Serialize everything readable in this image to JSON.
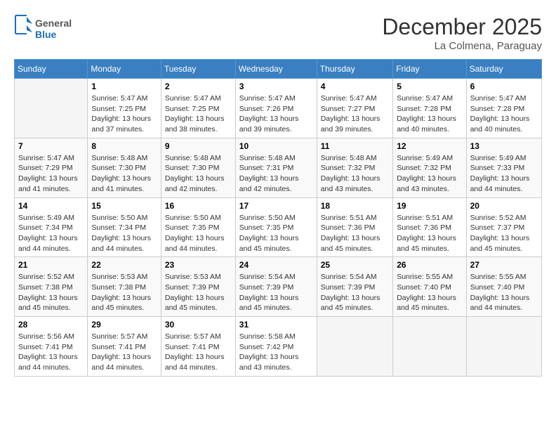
{
  "header": {
    "logo_general": "General",
    "logo_blue": "Blue",
    "month": "December 2025",
    "location": "La Colmena, Paraguay"
  },
  "weekdays": [
    "Sunday",
    "Monday",
    "Tuesday",
    "Wednesday",
    "Thursday",
    "Friday",
    "Saturday"
  ],
  "weeks": [
    [
      {
        "day": "",
        "sunrise": "",
        "sunset": "",
        "daylight": "",
        "empty": true
      },
      {
        "day": "1",
        "sunrise": "Sunrise: 5:47 AM",
        "sunset": "Sunset: 7:25 PM",
        "daylight": "Daylight: 13 hours and 37 minutes."
      },
      {
        "day": "2",
        "sunrise": "Sunrise: 5:47 AM",
        "sunset": "Sunset: 7:25 PM",
        "daylight": "Daylight: 13 hours and 38 minutes."
      },
      {
        "day": "3",
        "sunrise": "Sunrise: 5:47 AM",
        "sunset": "Sunset: 7:26 PM",
        "daylight": "Daylight: 13 hours and 39 minutes."
      },
      {
        "day": "4",
        "sunrise": "Sunrise: 5:47 AM",
        "sunset": "Sunset: 7:27 PM",
        "daylight": "Daylight: 13 hours and 39 minutes."
      },
      {
        "day": "5",
        "sunrise": "Sunrise: 5:47 AM",
        "sunset": "Sunset: 7:28 PM",
        "daylight": "Daylight: 13 hours and 40 minutes."
      },
      {
        "day": "6",
        "sunrise": "Sunrise: 5:47 AM",
        "sunset": "Sunset: 7:28 PM",
        "daylight": "Daylight: 13 hours and 40 minutes."
      }
    ],
    [
      {
        "day": "7",
        "sunrise": "Sunrise: 5:47 AM",
        "sunset": "Sunset: 7:29 PM",
        "daylight": "Daylight: 13 hours and 41 minutes."
      },
      {
        "day": "8",
        "sunrise": "Sunrise: 5:48 AM",
        "sunset": "Sunset: 7:30 PM",
        "daylight": "Daylight: 13 hours and 41 minutes."
      },
      {
        "day": "9",
        "sunrise": "Sunrise: 5:48 AM",
        "sunset": "Sunset: 7:30 PM",
        "daylight": "Daylight: 13 hours and 42 minutes."
      },
      {
        "day": "10",
        "sunrise": "Sunrise: 5:48 AM",
        "sunset": "Sunset: 7:31 PM",
        "daylight": "Daylight: 13 hours and 42 minutes."
      },
      {
        "day": "11",
        "sunrise": "Sunrise: 5:48 AM",
        "sunset": "Sunset: 7:32 PM",
        "daylight": "Daylight: 13 hours and 43 minutes."
      },
      {
        "day": "12",
        "sunrise": "Sunrise: 5:49 AM",
        "sunset": "Sunset: 7:32 PM",
        "daylight": "Daylight: 13 hours and 43 minutes."
      },
      {
        "day": "13",
        "sunrise": "Sunrise: 5:49 AM",
        "sunset": "Sunset: 7:33 PM",
        "daylight": "Daylight: 13 hours and 44 minutes."
      }
    ],
    [
      {
        "day": "14",
        "sunrise": "Sunrise: 5:49 AM",
        "sunset": "Sunset: 7:34 PM",
        "daylight": "Daylight: 13 hours and 44 minutes."
      },
      {
        "day": "15",
        "sunrise": "Sunrise: 5:50 AM",
        "sunset": "Sunset: 7:34 PM",
        "daylight": "Daylight: 13 hours and 44 minutes."
      },
      {
        "day": "16",
        "sunrise": "Sunrise: 5:50 AM",
        "sunset": "Sunset: 7:35 PM",
        "daylight": "Daylight: 13 hours and 44 minutes."
      },
      {
        "day": "17",
        "sunrise": "Sunrise: 5:50 AM",
        "sunset": "Sunset: 7:35 PM",
        "daylight": "Daylight: 13 hours and 45 minutes."
      },
      {
        "day": "18",
        "sunrise": "Sunrise: 5:51 AM",
        "sunset": "Sunset: 7:36 PM",
        "daylight": "Daylight: 13 hours and 45 minutes."
      },
      {
        "day": "19",
        "sunrise": "Sunrise: 5:51 AM",
        "sunset": "Sunset: 7:36 PM",
        "daylight": "Daylight: 13 hours and 45 minutes."
      },
      {
        "day": "20",
        "sunrise": "Sunrise: 5:52 AM",
        "sunset": "Sunset: 7:37 PM",
        "daylight": "Daylight: 13 hours and 45 minutes."
      }
    ],
    [
      {
        "day": "21",
        "sunrise": "Sunrise: 5:52 AM",
        "sunset": "Sunset: 7:38 PM",
        "daylight": "Daylight: 13 hours and 45 minutes."
      },
      {
        "day": "22",
        "sunrise": "Sunrise: 5:53 AM",
        "sunset": "Sunset: 7:38 PM",
        "daylight": "Daylight: 13 hours and 45 minutes."
      },
      {
        "day": "23",
        "sunrise": "Sunrise: 5:53 AM",
        "sunset": "Sunset: 7:39 PM",
        "daylight": "Daylight: 13 hours and 45 minutes."
      },
      {
        "day": "24",
        "sunrise": "Sunrise: 5:54 AM",
        "sunset": "Sunset: 7:39 PM",
        "daylight": "Daylight: 13 hours and 45 minutes."
      },
      {
        "day": "25",
        "sunrise": "Sunrise: 5:54 AM",
        "sunset": "Sunset: 7:39 PM",
        "daylight": "Daylight: 13 hours and 45 minutes."
      },
      {
        "day": "26",
        "sunrise": "Sunrise: 5:55 AM",
        "sunset": "Sunset: 7:40 PM",
        "daylight": "Daylight: 13 hours and 45 minutes."
      },
      {
        "day": "27",
        "sunrise": "Sunrise: 5:55 AM",
        "sunset": "Sunset: 7:40 PM",
        "daylight": "Daylight: 13 hours and 44 minutes."
      }
    ],
    [
      {
        "day": "28",
        "sunrise": "Sunrise: 5:56 AM",
        "sunset": "Sunset: 7:41 PM",
        "daylight": "Daylight: 13 hours and 44 minutes."
      },
      {
        "day": "29",
        "sunrise": "Sunrise: 5:57 AM",
        "sunset": "Sunset: 7:41 PM",
        "daylight": "Daylight: 13 hours and 44 minutes."
      },
      {
        "day": "30",
        "sunrise": "Sunrise: 5:57 AM",
        "sunset": "Sunset: 7:41 PM",
        "daylight": "Daylight: 13 hours and 44 minutes."
      },
      {
        "day": "31",
        "sunrise": "Sunrise: 5:58 AM",
        "sunset": "Sunset: 7:42 PM",
        "daylight": "Daylight: 13 hours and 43 minutes."
      },
      {
        "day": "",
        "sunrise": "",
        "sunset": "",
        "daylight": "",
        "empty": true
      },
      {
        "day": "",
        "sunrise": "",
        "sunset": "",
        "daylight": "",
        "empty": true
      },
      {
        "day": "",
        "sunrise": "",
        "sunset": "",
        "daylight": "",
        "empty": true
      }
    ]
  ]
}
